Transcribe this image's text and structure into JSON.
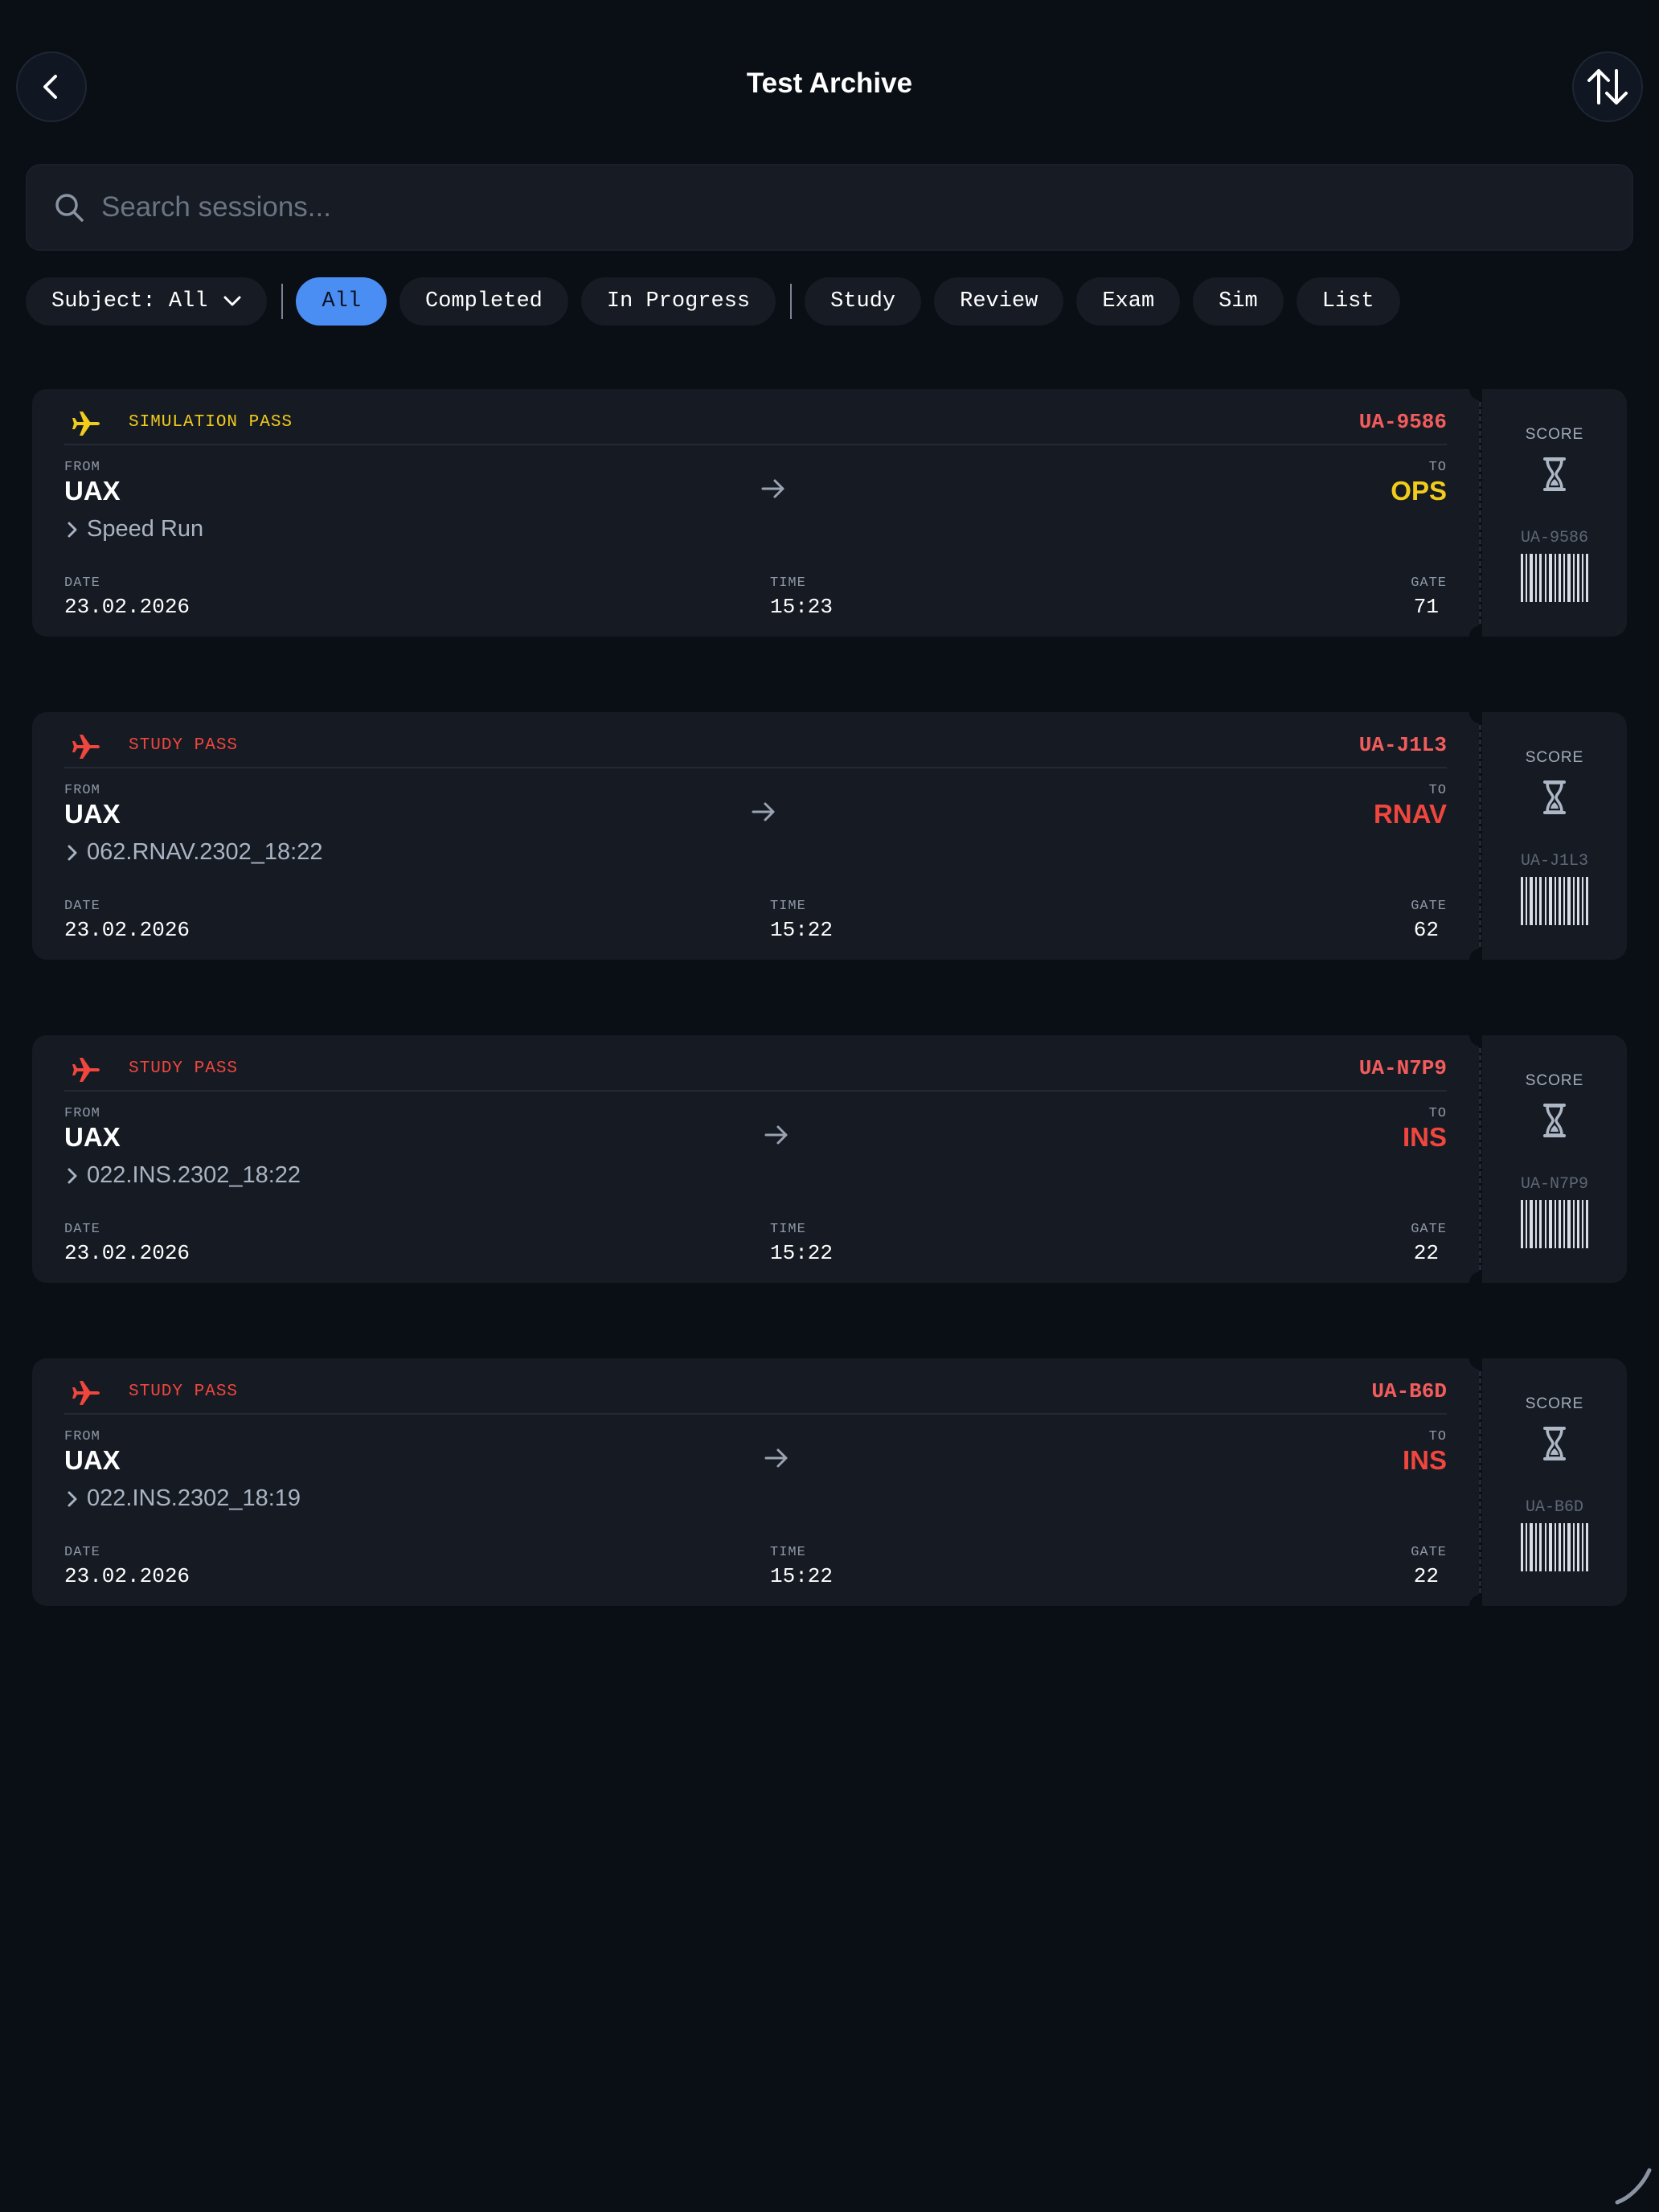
{
  "header": {
    "title": "Test Archive",
    "back_icon": "chevron-left-icon",
    "sort_icon": "sort-arrows-icon"
  },
  "search": {
    "placeholder": "Search sessions..."
  },
  "filters": {
    "subject": "Subject: All",
    "chips": [
      "All",
      "Completed",
      "In Progress"
    ],
    "types": [
      "Study",
      "Review",
      "Exam",
      "Sim",
      "List"
    ],
    "active": "All"
  },
  "colors": {
    "background": "#0a0e15",
    "card": "#161b23",
    "accent_blue": "#4a8ef4",
    "simulation_yellow": "#f2cc1b",
    "study_red": "#f0463e",
    "id_red": "#f25c5c"
  },
  "tickets": [
    {
      "type_label": "SIMULATION PASS",
      "pass_id": "UA-9586",
      "from_label": "FROM",
      "from_code": "UAX",
      "to_label": "TO",
      "to_code": "OPS",
      "subtitle": "Speed Run",
      "date_label": "DATE",
      "date": "23.02.2026",
      "time_label": "TIME",
      "time": "15:23",
      "gate_label": "GATE",
      "gate": "71",
      "score_label": "SCORE",
      "stub_id": "UA-9586"
    },
    {
      "type_label": "STUDY PASS",
      "pass_id": "UA-J1L3",
      "from_label": "FROM",
      "from_code": "UAX",
      "to_label": "TO",
      "to_code": "RNAV",
      "subtitle": "062.RNAV.2302_18:22",
      "date_label": "DATE",
      "date": "23.02.2026",
      "time_label": "TIME",
      "time": "15:22",
      "gate_label": "GATE",
      "gate": "62",
      "score_label": "SCORE",
      "stub_id": "UA-J1L3"
    },
    {
      "type_label": "STUDY PASS",
      "pass_id": "UA-N7P9",
      "from_label": "FROM",
      "from_code": "UAX",
      "to_label": "TO",
      "to_code": "INS",
      "subtitle": "022.INS.2302_18:22",
      "date_label": "DATE",
      "date": "23.02.2026",
      "time_label": "TIME",
      "time": "15:22",
      "gate_label": "GATE",
      "gate": "22",
      "score_label": "SCORE",
      "stub_id": "UA-N7P9"
    },
    {
      "type_label": "STUDY PASS",
      "pass_id": "UA-B6D",
      "from_label": "FROM",
      "from_code": "UAX",
      "to_label": "TO",
      "to_code": "INS",
      "subtitle": "022.INS.2302_18:19",
      "date_label": "DATE",
      "date": "23.02.2026",
      "time_label": "TIME",
      "time": "15:22",
      "gate_label": "GATE",
      "gate": "22",
      "score_label": "SCORE",
      "stub_id": "UA-B6D"
    }
  ]
}
